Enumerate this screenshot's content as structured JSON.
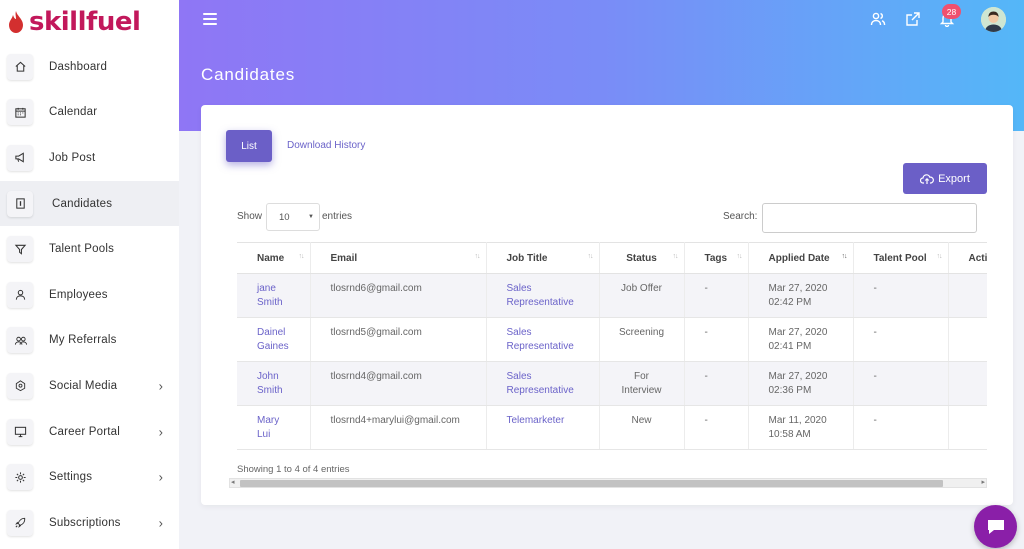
{
  "brand": {
    "name": "skillfuel",
    "color": "#c2185b"
  },
  "sidebar": {
    "items": [
      {
        "label": "Dashboard",
        "icon": "home-icon"
      },
      {
        "label": "Calendar",
        "icon": "calendar-icon"
      },
      {
        "label": "Job Post",
        "icon": "megaphone-icon"
      },
      {
        "label": "Candidates",
        "icon": "candidates-icon",
        "active": true
      },
      {
        "label": "Talent Pools",
        "icon": "filter-icon"
      },
      {
        "label": "Employees",
        "icon": "user-icon"
      },
      {
        "label": "My Referrals",
        "icon": "users-icon"
      },
      {
        "label": "Social Media",
        "icon": "share-icon",
        "chevron": "›"
      },
      {
        "label": "Career Portal",
        "icon": "monitor-icon",
        "chevron": "›"
      },
      {
        "label": "Settings",
        "icon": "gear-icon",
        "chevron": "›"
      },
      {
        "label": "Subscriptions",
        "icon": "rocket-icon",
        "chevron": "›"
      }
    ]
  },
  "header": {
    "title": "Candidates",
    "notification_count": "28",
    "gradient": [
      "#8f76f5",
      "#54b7f8"
    ]
  },
  "tabs": {
    "list": "List",
    "download_history": "Download History"
  },
  "toolbar": {
    "export_label": "Export",
    "show_label": "Show",
    "entries_value": "10",
    "entries_label": "entries",
    "search_label": "Search:",
    "search_value": ""
  },
  "table": {
    "columns": [
      "Name",
      "Email",
      "Job Title",
      "Status",
      "Tags",
      "Applied Date",
      "Talent Pool",
      "Acti"
    ],
    "rows": [
      {
        "name": [
          "jane",
          "Smith"
        ],
        "email": "tlosrnd6@gmail.com",
        "job_title": [
          "Sales",
          "Representative"
        ],
        "status": [
          "Job Offer"
        ],
        "tags": "-",
        "applied_date": [
          "Mar 27, 2020",
          "02:42 PM"
        ],
        "talent_pool": "-"
      },
      {
        "name": [
          "Dainel",
          "Gaines"
        ],
        "email": "tlosrnd5@gmail.com",
        "job_title": [
          "Sales",
          "Representative"
        ],
        "status": [
          "Screening"
        ],
        "tags": "-",
        "applied_date": [
          "Mar 27, 2020",
          "02:41 PM"
        ],
        "talent_pool": "-"
      },
      {
        "name": [
          "John",
          "Smith"
        ],
        "email": "tlosrnd4@gmail.com",
        "job_title": [
          "Sales",
          "Representative"
        ],
        "status": [
          "For",
          "Interview"
        ],
        "tags": "-",
        "applied_date": [
          "Mar 27, 2020",
          "02:36 PM"
        ],
        "talent_pool": "-"
      },
      {
        "name": [
          "Mary",
          "Lui"
        ],
        "email": "tlosrnd4+marylui@gmail.com",
        "job_title": [
          "Telemarketer"
        ],
        "status": [
          "New"
        ],
        "tags": "-",
        "applied_date": [
          "Mar 11, 2020",
          "10:58 AM"
        ],
        "talent_pool": "-"
      }
    ]
  },
  "footer": {
    "showing": "Showing 1 to 4 of 4 entries"
  },
  "accent": "#6b5fc7"
}
